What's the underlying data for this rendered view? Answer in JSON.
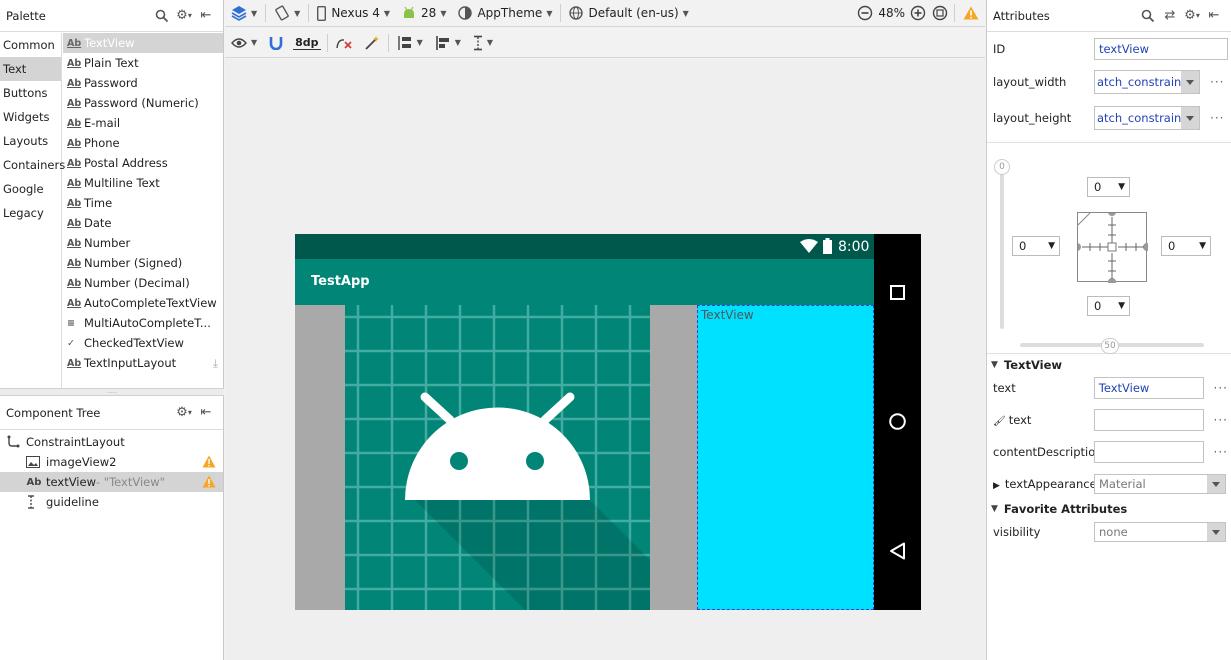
{
  "palette": {
    "title": "Palette",
    "categories": [
      "Common",
      "Text",
      "Buttons",
      "Widgets",
      "Layouts",
      "Containers",
      "Google",
      "Legacy"
    ],
    "selected_category": "Text",
    "widgets": [
      {
        "icon": "Ab",
        "label": "TextView"
      },
      {
        "icon": "Ab",
        "label": "Plain Text"
      },
      {
        "icon": "Ab",
        "label": "Password"
      },
      {
        "icon": "Ab",
        "label": "Password (Numeric)"
      },
      {
        "icon": "Ab",
        "label": "E-mail"
      },
      {
        "icon": "Ab",
        "label": "Phone"
      },
      {
        "icon": "Ab",
        "label": "Postal Address"
      },
      {
        "icon": "Ab",
        "label": "Multiline Text"
      },
      {
        "icon": "Ab",
        "label": "Time"
      },
      {
        "icon": "Ab",
        "label": "Date"
      },
      {
        "icon": "Ab",
        "label": "Number"
      },
      {
        "icon": "Ab",
        "label": "Number (Signed)"
      },
      {
        "icon": "Ab",
        "label": "Number (Decimal)"
      },
      {
        "icon": "Ab",
        "label": "AutoCompleteTextView"
      },
      {
        "icon": "≡",
        "label": "MultiAutoCompleteT..."
      },
      {
        "icon": "✓",
        "label": "CheckedTextView"
      },
      {
        "icon": "Ab",
        "label": "TextInputLayout"
      }
    ]
  },
  "component_tree": {
    "title": "Component Tree",
    "items": [
      {
        "icon": "Ab",
        "label": "ConstraintLayout",
        "suffix": "",
        "warn": false
      },
      {
        "icon": "Ab",
        "label": "imageView2",
        "suffix": "",
        "warn": true
      },
      {
        "icon": "Ab",
        "label": "textView",
        "suffix": "- \"TextView\"",
        "warn": true
      },
      {
        "icon": "I",
        "label": "guideline",
        "suffix": "",
        "warn": false
      }
    ]
  },
  "toolbar": {
    "device": "Nexus 4",
    "api": "28",
    "theme": "AppTheme",
    "locale": "Default (en-us)",
    "zoom": "48%",
    "margin": "8dp"
  },
  "device": {
    "time": "8:00",
    "app_title": "TestApp",
    "textview_text": "TextView"
  },
  "attributes": {
    "title": "Attributes",
    "id_label": "ID",
    "id_value": "textView",
    "layout_width_label": "layout_width",
    "layout_width_value": "atch_constraint",
    "layout_height_label": "layout_height",
    "layout_height_value": "atch_constraint",
    "bias_top": "0",
    "bias_bottom": "50",
    "margin_top": "0",
    "margin_left": "0",
    "margin_right": "0",
    "margin_bottom": "0",
    "section_textview": "TextView",
    "text_label": "text",
    "text_value": "TextView",
    "tools_text_label": "text",
    "tools_text_value": "",
    "content_desc_label": "contentDescriptio",
    "content_desc_value": "",
    "text_appearance_label": "textAppearance",
    "text_appearance_value": "Material",
    "section_favorites": "Favorite Attributes",
    "visibility_label": "visibility",
    "visibility_value": "none"
  },
  "colors": {
    "status_bar": "#00574b",
    "app_bar": "#008577",
    "textview_bg": "#00e1ff",
    "warning": "#f5a623"
  }
}
